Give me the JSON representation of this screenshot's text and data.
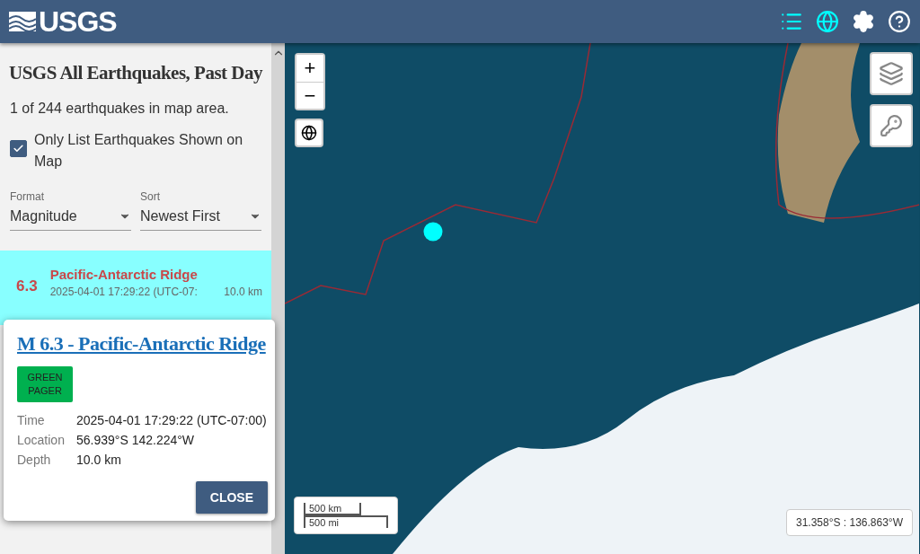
{
  "header": {
    "logo": "USGS",
    "icons": [
      {
        "kind": "list",
        "selected": true
      },
      {
        "kind": "map",
        "selected": true
      },
      {
        "kind": "settings",
        "selected": false
      },
      {
        "kind": "help",
        "selected": false
      }
    ]
  },
  "sidebar": {
    "title": "USGS All Earthquakes, Past Day",
    "count": "1 of 244 earthquakes in map area.",
    "only_list_shown": {
      "label": "Only List Earthquakes Shown on Map",
      "checked": true
    },
    "selects": [
      {
        "label": "Format",
        "value": "Magnitude"
      },
      {
        "label": "Sort",
        "value": "Newest First"
      }
    ],
    "events": [
      {
        "magnitude": "6.3",
        "place": "Pacific-Antarctic Ridge",
        "time": "2025-04-01 17:29:22 (UTC-07:",
        "depth": "10.0 km",
        "selected": true
      }
    ]
  },
  "popup": {
    "title": "M 6.3 - Pacific-Antarctic Ridge",
    "pager": {
      "text": "GREEN PAGER",
      "color": "#00b04f"
    },
    "details": [
      {
        "label": "Time",
        "value": "2025-04-01 17:29:22 (UTC-07:00)"
      },
      {
        "label": "Location",
        "value": "56.939°S 142.224°W"
      },
      {
        "label": "Depth",
        "value": "10.0 km"
      }
    ],
    "close": "CLOSE"
  },
  "map": {
    "zoom_in": "+",
    "zoom_out": "−",
    "scale": [
      "500 km",
      "500 mi"
    ],
    "coordinates": "31.358°S : 136.863°W"
  }
}
